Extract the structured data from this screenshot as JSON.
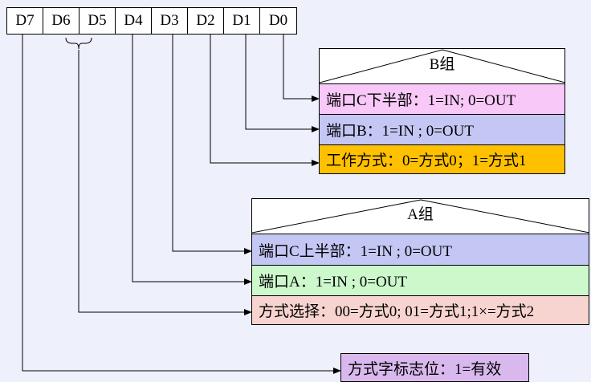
{
  "bits": [
    "D7",
    "D6",
    "D5",
    "D4",
    "D3",
    "D2",
    "D1",
    "D0"
  ],
  "group_b": {
    "title": "B组",
    "rows": [
      {
        "text": "端口C下半部：1=IN; 0=OUT",
        "color": "#f8c8f8"
      },
      {
        "text": "端口B：1=IN ; 0=OUT",
        "color": "#c4c6f4"
      },
      {
        "text": "工作方式：0=方式0；1=方式1",
        "color": "#ffc000"
      }
    ]
  },
  "group_a": {
    "title": "A组",
    "rows": [
      {
        "text": "端口C上半部：1=IN ; 0=OUT",
        "color": "#c4c6f4"
      },
      {
        "text": "端口A：1=IN ; 0=OUT",
        "color": "#ccf8cc"
      },
      {
        "text": "方式选择：00=方式0; 01=方式1;1×=方式2",
        "color": "#f8d4d0"
      }
    ]
  },
  "mode_flag": {
    "text": "方式字标志位：1=有效",
    "color": "#d9b8ee"
  }
}
